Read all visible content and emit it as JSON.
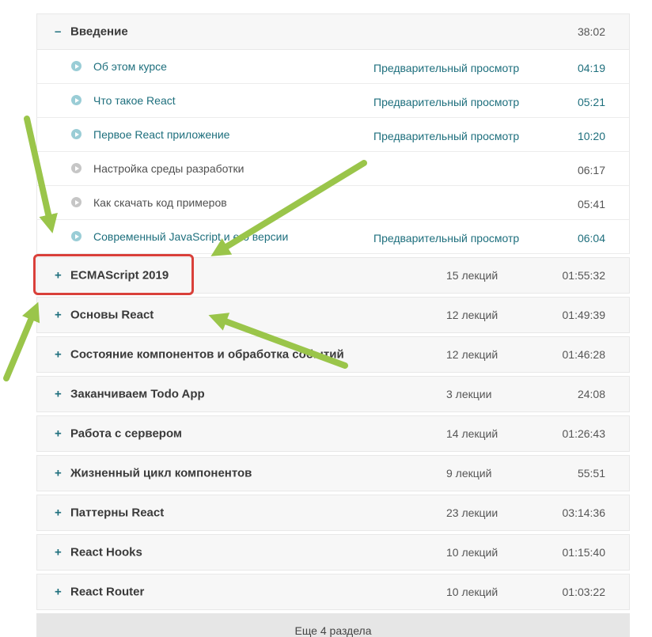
{
  "open_section": {
    "title": "Введение",
    "toggle": "–",
    "duration": "38:02",
    "lectures": [
      {
        "title": "Об этом курсе",
        "preview": "Предварительный просмотр",
        "duration": "04:19",
        "locked": false
      },
      {
        "title": "Что такое React",
        "preview": "Предварительный просмотр",
        "duration": "05:21",
        "locked": false
      },
      {
        "title": "Первое React приложение",
        "preview": "Предварительный просмотр",
        "duration": "10:20",
        "locked": false
      },
      {
        "title": "Настройка среды разработки",
        "preview": "",
        "duration": "06:17",
        "locked": true
      },
      {
        "title": "Как скачать код примеров",
        "preview": "",
        "duration": "05:41",
        "locked": true
      },
      {
        "title": "Современный JavaScript и его версии",
        "preview": "Предварительный просмотр",
        "duration": "06:04",
        "locked": false
      }
    ]
  },
  "sections": [
    {
      "toggle": "+",
      "title": "ECMAScript 2019",
      "count": "15 лекций",
      "duration": "01:55:32"
    },
    {
      "toggle": "+",
      "title": "Основы React",
      "count": "12 лекций",
      "duration": "01:49:39"
    },
    {
      "toggle": "+",
      "title": "Состояние компонентов и обработка событий",
      "count": "12 лекций",
      "duration": "01:46:28"
    },
    {
      "toggle": "+",
      "title": "Заканчиваем Todo App",
      "count": "3 лекции",
      "duration": "24:08"
    },
    {
      "toggle": "+",
      "title": "Работа с сервером",
      "count": "14 лекций",
      "duration": "01:26:43"
    },
    {
      "toggle": "+",
      "title": "Жизненный цикл компонентов",
      "count": "9 лекций",
      "duration": "55:51"
    },
    {
      "toggle": "+",
      "title": "Паттерны React",
      "count": "23 лекции",
      "duration": "03:14:36"
    },
    {
      "toggle": "+",
      "title": "React Hooks",
      "count": "10 лекций",
      "duration": "01:15:40"
    },
    {
      "toggle": "+",
      "title": "React Router",
      "count": "10 лекций",
      "duration": "01:03:22"
    }
  ],
  "more_sections_label": "Еще 4 раздела",
  "annotation_colors": {
    "arrow": "#9ac54a",
    "highlight": "#d9403a"
  }
}
